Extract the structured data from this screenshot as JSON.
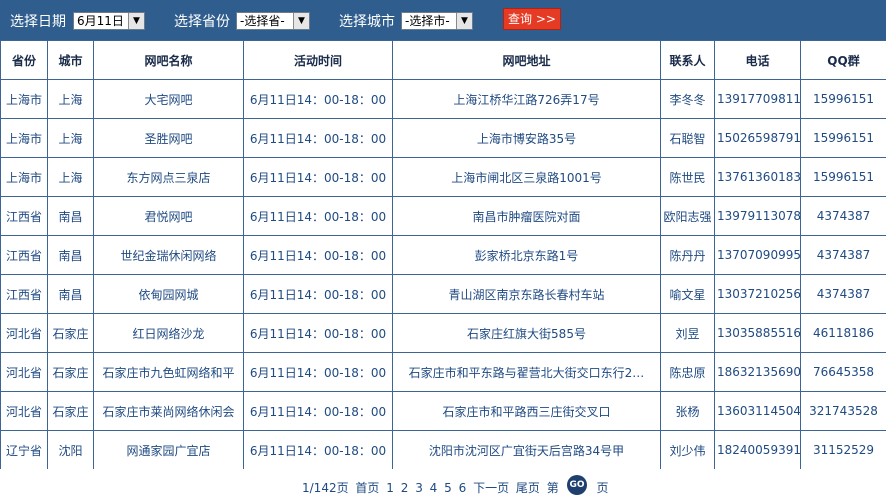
{
  "filter": {
    "date_label": "选择日期",
    "date_value": "6月11日",
    "province_label": "选择省份",
    "province_value": "-选择省-",
    "city_label": "选择城市",
    "city_value": "-选择市-",
    "query_label": "查询",
    "query_icon": "double-chevron-right"
  },
  "table": {
    "headers": [
      "省份",
      "城市",
      "网吧名称",
      "活动时间",
      "网吧地址",
      "联系人",
      "电话",
      "QQ群"
    ],
    "rows": [
      [
        "上海市",
        "上海",
        "大宅网吧",
        "6月11日14：00-18：00",
        "上海江桥华江路726弄17号",
        "李冬冬",
        "13917709811",
        "15996151"
      ],
      [
        "上海市",
        "上海",
        "圣胜网吧",
        "6月11日14：00-18：00",
        "上海市博安路35号",
        "石聪智",
        "15026598791",
        "15996151"
      ],
      [
        "上海市",
        "上海",
        "东方网点三泉店",
        "6月11日14：00-18：00",
        "上海市闸北区三泉路1001号",
        "陈世民",
        "13761360183",
        "15996151"
      ],
      [
        "江西省",
        "南昌",
        "君悦网吧",
        "6月11日14：00-18：00",
        "南昌市肿瘤医院对面",
        "欧阳志强",
        "13979113078",
        "4374387"
      ],
      [
        "江西省",
        "南昌",
        "世纪金瑞休闲网络",
        "6月11日14：00-18：00",
        "彭家桥北京东路1号",
        "陈丹丹",
        "13707090995",
        "4374387"
      ],
      [
        "江西省",
        "南昌",
        "依甸园网城",
        "6月11日14：00-18：00",
        "青山湖区南京东路长春村车站",
        "喻文星",
        "13037210256",
        "4374387"
      ],
      [
        "河北省",
        "石家庄",
        "红日网络沙龙",
        "6月11日14：00-18：00",
        "石家庄红旗大街585号",
        "刘昱",
        "13035885516",
        "46118186"
      ],
      [
        "河北省",
        "石家庄",
        "石家庄市九色虹网络和平",
        "6月11日14：00-18：00",
        "石家庄市和平东路与翟营北大街交口东行2…",
        "陈忠原",
        "18632135690",
        "76645358"
      ],
      [
        "河北省",
        "石家庄",
        "石家庄市莱尚网络休闲会",
        "6月11日14：00-18：00",
        "石家庄市和平路西三庄街交叉口",
        "张杨",
        "13603114504",
        "321743528"
      ],
      [
        "辽宁省",
        "沈阳",
        "网通家园广宜店",
        "6月11日14：00-18：00",
        "沈阳市沈河区广宜街天后宫路34号甲",
        "刘少伟",
        "18240059391",
        "31152529"
      ]
    ]
  },
  "pager": {
    "page_info": "1/142页",
    "first": "首页",
    "pages": [
      "1",
      "2",
      "3",
      "4",
      "5",
      "6"
    ],
    "next": "下一页",
    "last": "尾页",
    "di": "第",
    "ye": "页",
    "go": "GO"
  },
  "colors": {
    "bar_bg": "#2f5e8e",
    "border": "#3c6593",
    "text": "#1f4a82",
    "query_btn": "#e53b25",
    "go_btn": "#1f3f6e"
  }
}
